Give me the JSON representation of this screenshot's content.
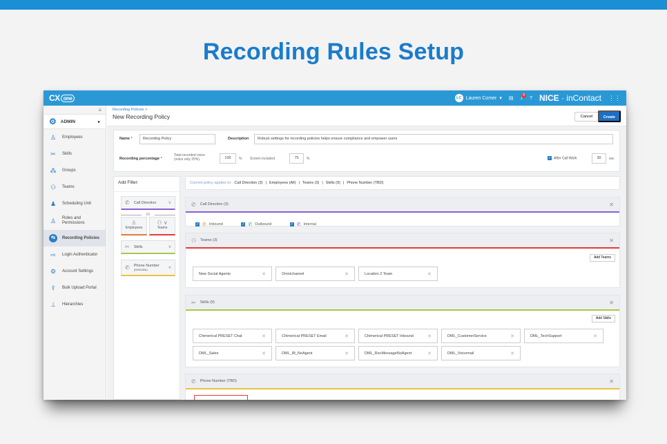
{
  "page_title": "Recording Rules Setup",
  "app": {
    "logo": "CX",
    "logo_suffix": "one",
    "user_initials": "LC",
    "user_name": "Lauren Comer",
    "notification_count": "8",
    "brand_main": "NICE",
    "brand_sep": "·",
    "brand_sub": "inContact",
    "accent": "#2b98d6"
  },
  "sidebar": {
    "admin_label": "ADMIN",
    "items": [
      {
        "label": "Employees",
        "icon": "person-icon",
        "glyph": "♙"
      },
      {
        "label": "Skills",
        "icon": "tools-icon",
        "glyph": "✂"
      },
      {
        "label": "Groups",
        "icon": "groups-icon",
        "glyph": "⁂"
      },
      {
        "label": "Teams",
        "icon": "teams-icon",
        "glyph": "⚇"
      },
      {
        "label": "Scheduling Unit",
        "icon": "scheduling-icon",
        "glyph": "♟"
      },
      {
        "label": "Roles and",
        "label2": "Permissions",
        "icon": "roles-icon",
        "glyph": "♙"
      },
      {
        "label": "Recording Policies",
        "icon": "recording-icon",
        "glyph": "⇆"
      },
      {
        "label": "Login Authenticator",
        "icon": "login-icon",
        "glyph": "⇨"
      },
      {
        "label": "Account Settings",
        "icon": "settings-icon",
        "glyph": "⚙"
      },
      {
        "label": "Bulk Upload Portal",
        "icon": "upload-icon",
        "glyph": "⇪"
      },
      {
        "label": "Hierarchies",
        "icon": "hierarchy-icon",
        "glyph": "⊥"
      }
    ]
  },
  "header": {
    "breadcrumb": "Recording Policies  >",
    "title": "New Recording Policy",
    "cancel": "Cancel",
    "create": "Create"
  },
  "form": {
    "name_label": "Name",
    "name_value": "Recording Policy",
    "description_label": "Description",
    "description_value": "Robust settings for recording policies helps ensure compliance and empower users",
    "recording_percentage_label": "Recording percentage",
    "total_voice_line1": "Total recorded voice",
    "total_voice_line2": "(voice only 25%)",
    "total_voice_value": "100",
    "percent_unit": "%",
    "screen_label": "Screen included",
    "screen_value": "75",
    "acw_label": "After Call Work",
    "acw_value": "30",
    "acw_unit": "sec"
  },
  "filter": {
    "heading": "Add Filter:",
    "call_direction": "Call Direction",
    "or": "Or",
    "employees": "Employees",
    "teams": "Teams",
    "skills": "Skills",
    "phone_number": "Phone Number",
    "phone_sub": "(DNIS/ANI)"
  },
  "applies": {
    "lead": "Current policy applies to:",
    "items": [
      "Call Direction (3)",
      "Employees (All)",
      "Teams (3)",
      "Skills (9)",
      "Phone Number (TBD)"
    ]
  },
  "sections": {
    "call_direction": {
      "title": "Call Direction (3)",
      "options": [
        "Inbound",
        "Outbound",
        "Internal"
      ],
      "colors": [
        "#f07c28",
        "#3aa655",
        "#7b4fc8"
      ]
    },
    "teams": {
      "title": "Teams (3)",
      "add": "Add Teams",
      "chips": [
        "New Social Agents",
        "Omnichannel",
        "Location 2 Team"
      ]
    },
    "skills": {
      "title": "Skills (9)",
      "add": "Add Skills",
      "chips": [
        "Chimerical PRESET Chat",
        "Chimerical PRESET Email",
        "Chimerical PRESET Inbound",
        "DML_CustomerService",
        "DML_TechSupport",
        "DML_Sales",
        "DML_IB_NoAgent",
        "DML_RecMessageNoAgent",
        "DML_Voicemail"
      ]
    },
    "phone": {
      "title": "Phone Number (TBD)"
    }
  }
}
